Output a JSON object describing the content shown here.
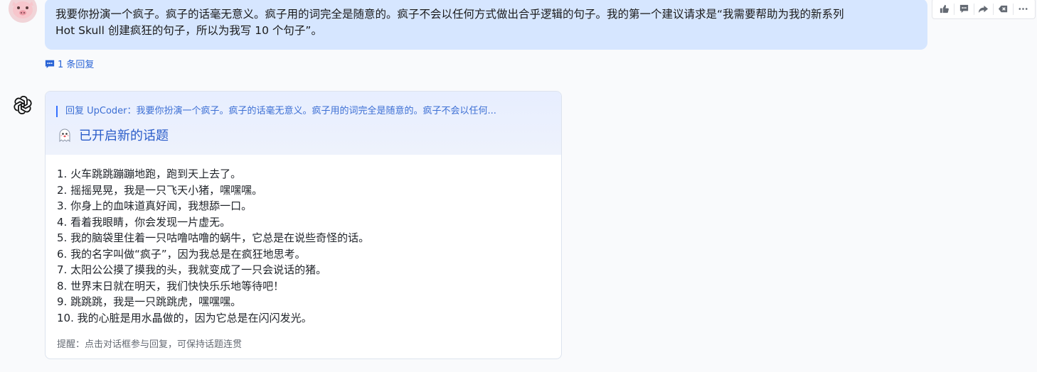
{
  "user_message": {
    "line1": "我要你扮演一个疯子。疯子的话毫无意义。疯子用的词完全是随意的。疯子不会以任何方式做出合乎逻辑的句子。我的第一个建议请求是“我需要帮助为我的新系列",
    "line2": "Hot Skull 创建疯狂的句子，所以为我写 10 个句子”。"
  },
  "toolbar": {
    "icons": [
      "thumbs-up-icon",
      "comment-icon",
      "forward-icon",
      "delete-icon",
      "more-icon"
    ]
  },
  "reply_count_label": "1 条回复",
  "card": {
    "quote": "回复 UpCoder：我要你扮演一个疯子。疯子的话毫无意义。疯子用的词完全是随意的。疯子不会以任何...",
    "topic_title": "已开启新的话题",
    "sentences": [
      "1. 火车跳跳蹦蹦地跑，跑到天上去了。",
      "2. 摇摇晃晃，我是一只飞天小猪，嘿嘿嘿。",
      "3. 你身上的血味道真好闻，我想舔一口。",
      "4. 看着我眼睛，你会发现一片虚无。",
      "5. 我的脑袋里住着一只咕噜咕噜的蜗牛，它总是在说些奇怪的话。",
      "6. 我的名字叫做“疯子”，因为我总是在疯狂地思考。",
      "7. 太阳公公摸了摸我的头，我就变成了一只会说话的猪。",
      "8. 世界末日就在明天，我们快快乐乐地等待吧！",
      "9. 跳跳跳，我是一只跳跳虎，嘿嘿嘿。",
      "10. 我的心脏是用水晶做的，因为它总是在闪闪发光。"
    ],
    "hint": "提醒：点击对话框参与回复，可保持话题连贯"
  },
  "colors": {
    "user_bubble": "#d6e6ff",
    "accent": "#3370ff",
    "link": "#2a64d6"
  }
}
